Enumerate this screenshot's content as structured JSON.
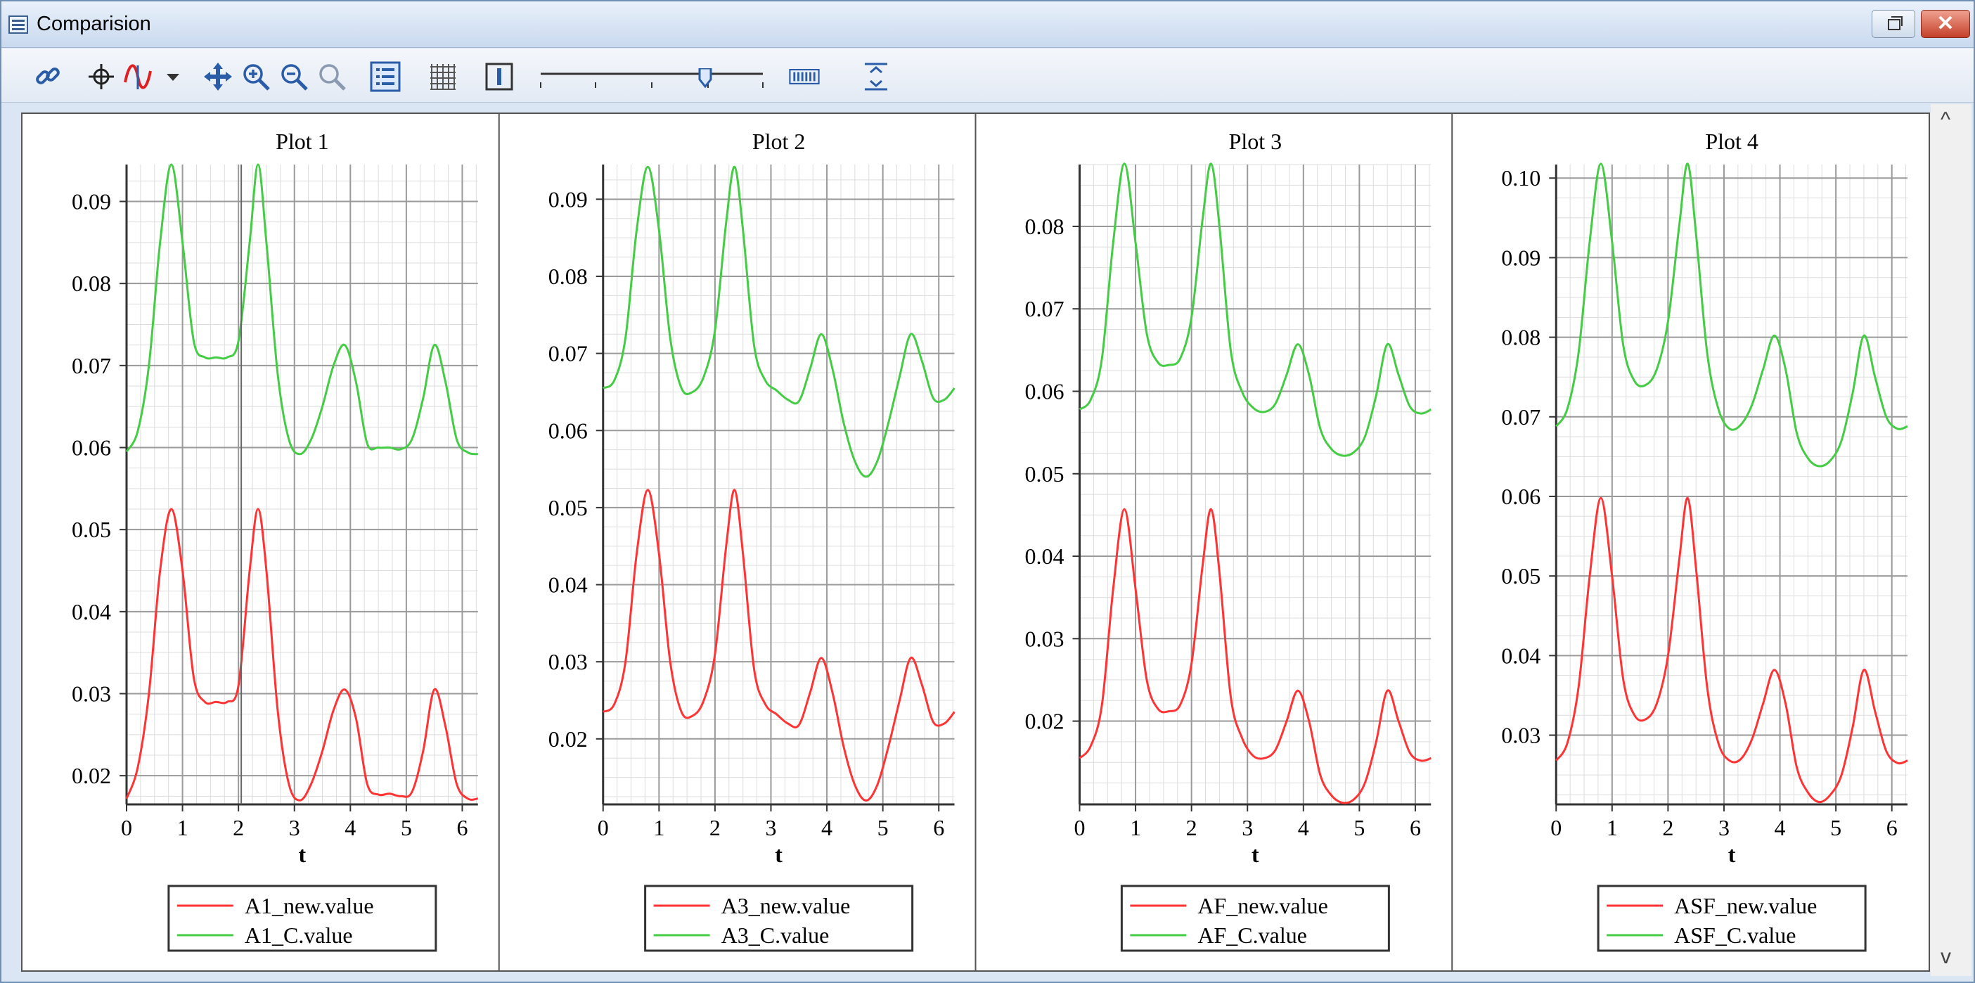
{
  "window": {
    "title": "Comparision",
    "close_label": "✕"
  },
  "toolbar": {
    "icons": [
      "link-icon",
      "crosshair-icon",
      "curve-icon",
      "dropdown-arrow-icon",
      "pan-icon",
      "zoom-in-icon",
      "zoom-out-icon",
      "zoom-fit-icon",
      "legend-toggle-icon",
      "grid-toggle-icon",
      "column-icon",
      "resolution-slider",
      "barcode-icon",
      "fit-height-icon"
    ]
  },
  "colors": {
    "red": "#ff3333",
    "green": "#44cc44",
    "grid": "#9a9a9a",
    "minor_grid": "#dddddd"
  },
  "chart_data": [
    {
      "type": "line",
      "title": "Plot 1",
      "xlabel": "t",
      "xlim": [
        0,
        6.28
      ],
      "ylim": [
        0.0165,
        0.0945
      ],
      "xticks": [
        "0",
        "1",
        "2",
        "3",
        "4",
        "5",
        "6"
      ],
      "yticks": [
        "0.02",
        "0.03",
        "0.04",
        "0.05",
        "0.06",
        "0.07",
        "0.08",
        "0.09"
      ],
      "ytick_values": [
        0.02,
        0.03,
        0.04,
        0.05,
        0.06,
        0.07,
        0.08,
        0.09
      ],
      "series": [
        {
          "name": "A1_new.value",
          "color": "#ff3333",
          "x": [
            0,
            0.2,
            0.4,
            0.6,
            0.8,
            1.0,
            1.2,
            1.4,
            1.6,
            1.8,
            2.0,
            2.2,
            2.35,
            2.5,
            2.7,
            2.9,
            3.1,
            3.3,
            3.5,
            3.7,
            3.9,
            4.1,
            4.3,
            4.5,
            4.7,
            4.9,
            5.1,
            5.3,
            5.5,
            5.7,
            5.9,
            6.1,
            6.28
          ],
          "y": [
            0.0172,
            0.021,
            0.03,
            0.045,
            0.0525,
            0.045,
            0.032,
            0.029,
            0.029,
            0.029,
            0.031,
            0.045,
            0.0525,
            0.045,
            0.028,
            0.019,
            0.017,
            0.019,
            0.023,
            0.028,
            0.0305,
            0.027,
            0.019,
            0.0177,
            0.0178,
            0.0175,
            0.018,
            0.023,
            0.0305,
            0.026,
            0.019,
            0.0172,
            0.0172
          ]
        },
        {
          "name": "A1_C.value",
          "color": "#44cc44",
          "x": [
            0,
            0.2,
            0.4,
            0.6,
            0.8,
            1.0,
            1.2,
            1.4,
            1.6,
            1.8,
            2.0,
            2.2,
            2.35,
            2.5,
            2.7,
            2.9,
            3.1,
            3.3,
            3.5,
            3.7,
            3.9,
            4.1,
            4.3,
            4.5,
            4.7,
            4.9,
            5.1,
            5.3,
            5.5,
            5.7,
            5.9,
            6.1,
            6.28
          ],
          "y": [
            0.0595,
            0.062,
            0.07,
            0.085,
            0.0945,
            0.085,
            0.073,
            0.071,
            0.071,
            0.071,
            0.073,
            0.085,
            0.0945,
            0.085,
            0.069,
            0.061,
            0.0592,
            0.061,
            0.065,
            0.07,
            0.0725,
            0.068,
            0.0605,
            0.06,
            0.06,
            0.0598,
            0.061,
            0.066,
            0.0725,
            0.068,
            0.061,
            0.0594,
            0.0592
          ]
        }
      ]
    },
    {
      "type": "line",
      "title": "Plot 2",
      "xlabel": "t",
      "xlim": [
        0,
        6.28
      ],
      "ylim": [
        0.0115,
        0.0945
      ],
      "xticks": [
        "0",
        "1",
        "2",
        "3",
        "4",
        "5",
        "6"
      ],
      "yticks": [
        "0.02",
        "0.03",
        "0.04",
        "0.05",
        "0.06",
        "0.07",
        "0.08",
        "0.09"
      ],
      "ytick_values": [
        0.02,
        0.03,
        0.04,
        0.05,
        0.06,
        0.07,
        0.08,
        0.09
      ],
      "series": [
        {
          "name": "A3_new.value",
          "color": "#ff3333",
          "x": [
            0,
            0.2,
            0.4,
            0.6,
            0.8,
            1.0,
            1.2,
            1.4,
            1.6,
            1.8,
            2.0,
            2.2,
            2.35,
            2.5,
            2.7,
            2.9,
            3.1,
            3.3,
            3.5,
            3.7,
            3.9,
            4.1,
            4.3,
            4.5,
            4.7,
            4.9,
            5.1,
            5.3,
            5.5,
            5.7,
            5.9,
            6.1,
            6.28
          ],
          "y": [
            0.0235,
            0.0245,
            0.03,
            0.044,
            0.0523,
            0.044,
            0.03,
            0.0235,
            0.023,
            0.025,
            0.031,
            0.045,
            0.0523,
            0.044,
            0.029,
            0.0245,
            0.0232,
            0.022,
            0.0218,
            0.026,
            0.0305,
            0.026,
            0.019,
            0.014,
            0.012,
            0.014,
            0.019,
            0.025,
            0.0305,
            0.027,
            0.0222,
            0.022,
            0.0235
          ]
        },
        {
          "name": "A3_C.value",
          "color": "#44cc44",
          "x": [
            0,
            0.2,
            0.4,
            0.6,
            0.8,
            1.0,
            1.2,
            1.4,
            1.6,
            1.8,
            2.0,
            2.2,
            2.35,
            2.5,
            2.7,
            2.9,
            3.1,
            3.3,
            3.5,
            3.7,
            3.9,
            4.1,
            4.3,
            4.5,
            4.7,
            4.9,
            5.1,
            5.3,
            5.5,
            5.7,
            5.9,
            6.1,
            6.28
          ],
          "y": [
            0.0655,
            0.0665,
            0.072,
            0.086,
            0.0942,
            0.086,
            0.072,
            0.0655,
            0.065,
            0.067,
            0.073,
            0.087,
            0.0942,
            0.086,
            0.071,
            0.0665,
            0.0652,
            0.064,
            0.0638,
            0.068,
            0.0725,
            0.068,
            0.061,
            0.056,
            0.054,
            0.056,
            0.061,
            0.067,
            0.0725,
            0.069,
            0.0642,
            0.064,
            0.0655
          ]
        }
      ]
    },
    {
      "type": "line",
      "title": "Plot 3",
      "xlabel": "t",
      "xlim": [
        0,
        6.28
      ],
      "ylim": [
        0.0099,
        0.0875
      ],
      "xticks": [
        "0",
        "1",
        "2",
        "3",
        "4",
        "5",
        "6"
      ],
      "yticks": [
        "0.02",
        "0.03",
        "0.04",
        "0.05",
        "0.06",
        "0.07",
        "0.08"
      ],
      "ytick_values": [
        0.02,
        0.03,
        0.04,
        0.05,
        0.06,
        0.07,
        0.08
      ],
      "series": [
        {
          "name": "AF_new.value",
          "color": "#ff3333",
          "x": [
            0,
            0.2,
            0.4,
            0.6,
            0.8,
            1.0,
            1.2,
            1.4,
            1.6,
            1.8,
            2.0,
            2.2,
            2.35,
            2.5,
            2.7,
            2.9,
            3.1,
            3.3,
            3.5,
            3.7,
            3.9,
            4.1,
            4.3,
            4.5,
            4.7,
            4.9,
            5.1,
            5.3,
            5.5,
            5.7,
            5.9,
            6.1,
            6.28
          ],
          "y": [
            0.0155,
            0.017,
            0.022,
            0.036,
            0.0457,
            0.036,
            0.025,
            0.0215,
            0.0212,
            0.022,
            0.027,
            0.039,
            0.0457,
            0.038,
            0.023,
            0.018,
            0.0158,
            0.0155,
            0.0165,
            0.02,
            0.0237,
            0.02,
            0.0135,
            0.011,
            0.0101,
            0.0105,
            0.0125,
            0.0175,
            0.0237,
            0.02,
            0.0162,
            0.0152,
            0.0155
          ]
        },
        {
          "name": "AF_C.value",
          "color": "#44cc44",
          "x": [
            0,
            0.2,
            0.4,
            0.6,
            0.8,
            1.0,
            1.2,
            1.4,
            1.6,
            1.8,
            2.0,
            2.2,
            2.35,
            2.5,
            2.7,
            2.9,
            3.1,
            3.3,
            3.5,
            3.7,
            3.9,
            4.1,
            4.3,
            4.5,
            4.7,
            4.9,
            5.1,
            5.3,
            5.5,
            5.7,
            5.9,
            6.1,
            6.28
          ],
          "y": [
            0.0578,
            0.059,
            0.064,
            0.078,
            0.0876,
            0.078,
            0.067,
            0.0635,
            0.0632,
            0.064,
            0.069,
            0.081,
            0.0876,
            0.08,
            0.065,
            0.06,
            0.058,
            0.0575,
            0.0585,
            0.062,
            0.0657,
            0.062,
            0.0555,
            0.053,
            0.0522,
            0.0526,
            0.0545,
            0.0595,
            0.0657,
            0.062,
            0.0582,
            0.0573,
            0.0578
          ]
        }
      ]
    },
    {
      "type": "line",
      "title": "Plot 4",
      "xlabel": "t",
      "xlim": [
        0,
        6.28
      ],
      "ylim": [
        0.0213,
        0.1017
      ],
      "xticks": [
        "0",
        "1",
        "2",
        "3",
        "4",
        "5",
        "6"
      ],
      "yticks": [
        "0.03",
        "0.04",
        "0.05",
        "0.06",
        "0.07",
        "0.08",
        "0.09",
        "0.10"
      ],
      "ytick_values": [
        0.03,
        0.04,
        0.05,
        0.06,
        0.07,
        0.08,
        0.09,
        0.1
      ],
      "series": [
        {
          "name": "ASF_new.value",
          "color": "#ff3333",
          "x": [
            0,
            0.2,
            0.4,
            0.6,
            0.8,
            1.0,
            1.2,
            1.4,
            1.6,
            1.8,
            2.0,
            2.2,
            2.35,
            2.5,
            2.7,
            2.9,
            3.1,
            3.3,
            3.5,
            3.7,
            3.9,
            4.1,
            4.3,
            4.5,
            4.7,
            4.9,
            5.1,
            5.3,
            5.5,
            5.7,
            5.9,
            6.1,
            6.28
          ],
          "y": [
            0.0268,
            0.029,
            0.036,
            0.05,
            0.0598,
            0.05,
            0.037,
            0.0325,
            0.032,
            0.034,
            0.04,
            0.052,
            0.0598,
            0.051,
            0.036,
            0.029,
            0.0268,
            0.027,
            0.0295,
            0.034,
            0.0382,
            0.034,
            0.026,
            0.0228,
            0.0216,
            0.0225,
            0.025,
            0.031,
            0.0382,
            0.033,
            0.028,
            0.0265,
            0.0268
          ]
        },
        {
          "name": "ASF_C.value",
          "color": "#44cc44",
          "x": [
            0,
            0.2,
            0.4,
            0.6,
            0.8,
            1.0,
            1.2,
            1.4,
            1.6,
            1.8,
            2.0,
            2.2,
            2.35,
            2.5,
            2.7,
            2.9,
            3.1,
            3.3,
            3.5,
            3.7,
            3.9,
            4.1,
            4.3,
            4.5,
            4.7,
            4.9,
            5.1,
            5.3,
            5.5,
            5.7,
            5.9,
            6.1,
            6.28
          ],
          "y": [
            0.0688,
            0.071,
            0.078,
            0.092,
            0.1018,
            0.092,
            0.079,
            0.0745,
            0.074,
            0.076,
            0.082,
            0.094,
            0.1018,
            0.093,
            0.078,
            0.071,
            0.0685,
            0.069,
            0.0715,
            0.076,
            0.0802,
            0.076,
            0.068,
            0.0648,
            0.0638,
            0.0645,
            0.067,
            0.073,
            0.0802,
            0.075,
            0.07,
            0.0685,
            0.0688
          ]
        }
      ]
    }
  ]
}
